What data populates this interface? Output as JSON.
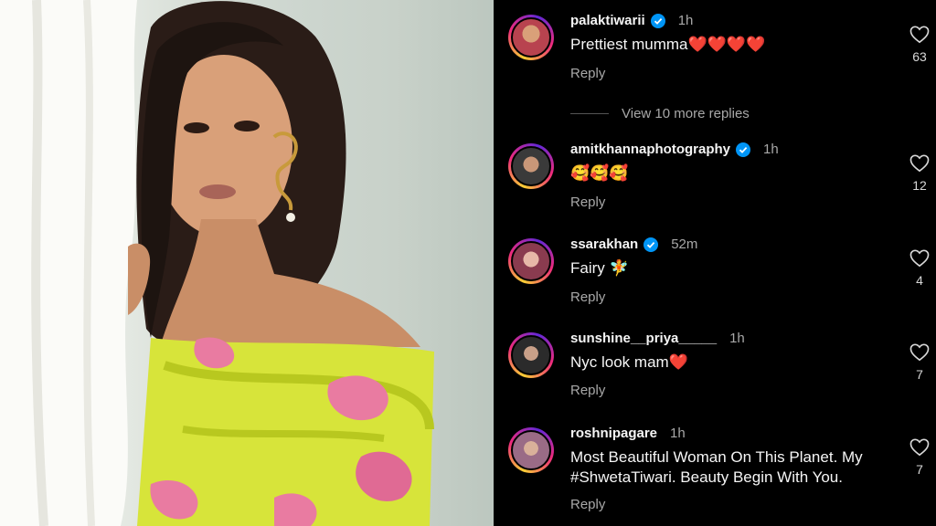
{
  "comments": [
    {
      "username": "palaktiwarii",
      "verified": true,
      "time": "1h",
      "text": "Prettiest mumma❤️❤️❤️❤️",
      "reply_label": "Reply",
      "likes": "63",
      "avatar_color": "#b8434f"
    },
    {
      "username": "amitkhannaphotography",
      "verified": true,
      "time": "1h",
      "text": "🥰🥰🥰",
      "reply_label": "Reply",
      "likes": "12",
      "avatar_color": "#3a3a3a"
    },
    {
      "username": "ssarakhan",
      "verified": true,
      "time": "52m",
      "text": "Fairy 🧚",
      "reply_label": "Reply",
      "likes": "4",
      "avatar_color": "#8a3b4f"
    },
    {
      "username": "sunshine__priya_____",
      "verified": false,
      "time": "1h",
      "text": "Nyc look mam❤️",
      "reply_label": "Reply",
      "likes": "7",
      "avatar_color": "#2b2b2b"
    },
    {
      "username": "roshnipagare",
      "verified": false,
      "time": "1h",
      "text": "Most Beautiful Woman On This Planet. My #ShwetaTiwari.  Beauty  Begin With You.",
      "reply_label": "Reply",
      "likes": "7",
      "avatar_color": "#9a6b86"
    }
  ],
  "view_replies": "View 10 more replies",
  "colors": {
    "verified": "#0095f6",
    "background": "#000000",
    "muted": "#a8a8a8"
  },
  "icons": {
    "like": "heart-outline-icon",
    "verified": "verified-badge-icon"
  }
}
